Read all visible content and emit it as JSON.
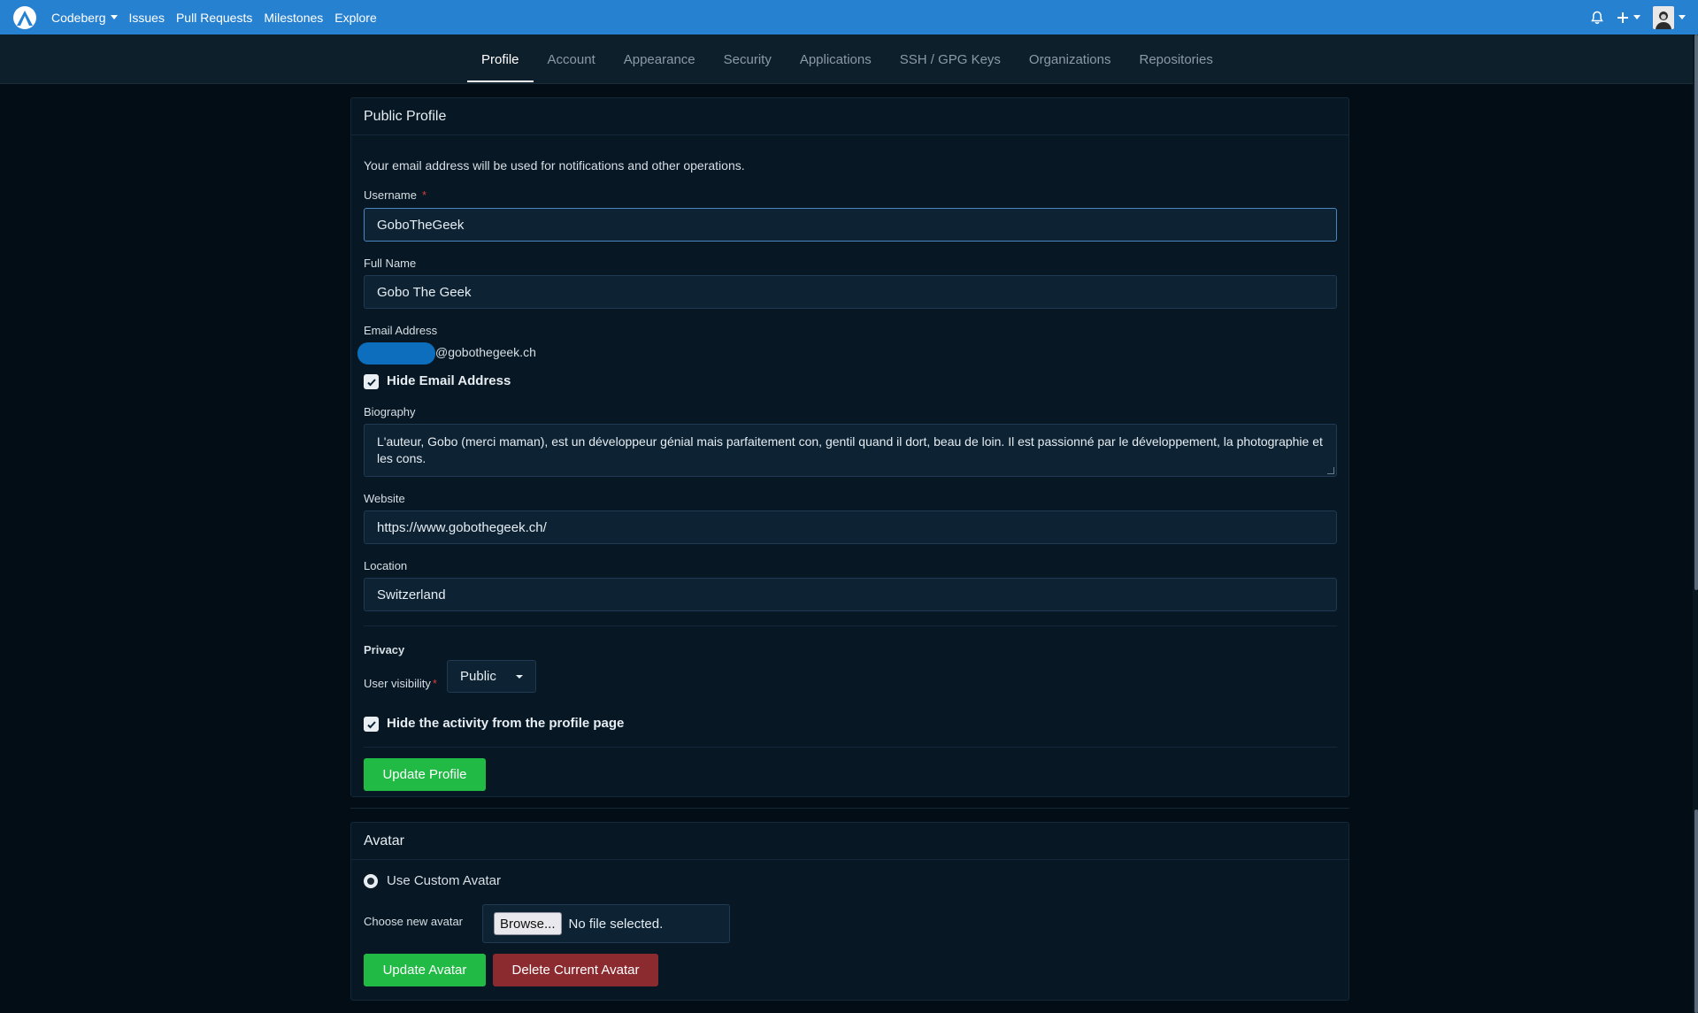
{
  "navbar": {
    "brand": "Codeberg",
    "links": [
      "Issues",
      "Pull Requests",
      "Milestones",
      "Explore"
    ]
  },
  "tabs": [
    "Profile",
    "Account",
    "Appearance",
    "Security",
    "Applications",
    "SSH / GPG Keys",
    "Organizations",
    "Repositories"
  ],
  "profile": {
    "heading": "Public Profile",
    "email_note": "Your email address will be used for notifications and other operations.",
    "username_label": "Username",
    "required_mark": "*",
    "username_value": "GoboTheGeek",
    "fullname_label": "Full Name",
    "fullname_value": "Gobo The Geek",
    "email_label": "Email Address",
    "email_domain": "@gobothegeek.ch",
    "hide_email_label": "Hide Email Address",
    "bio_label": "Biography",
    "bio_value": "L'auteur, Gobo (merci maman), est un développeur génial mais parfaitement con, gentil quand il dort, beau de loin. Il est passionné par le développement, la photographie et les cons.",
    "website_label": "Website",
    "website_value": "https://www.gobothegeek.ch/",
    "location_label": "Location",
    "location_value": "Switzerland",
    "privacy_label": "Privacy",
    "visibility_label": "User visibility",
    "visibility_value": "Public",
    "hide_activity_label": "Hide the activity from the profile page",
    "update_button": "Update Profile"
  },
  "avatar": {
    "heading": "Avatar",
    "custom_avatar_label": "Use Custom Avatar",
    "choose_label": "Choose new avatar",
    "browse_label": "Browse...",
    "no_file_label": "No file selected.",
    "update_button": "Update Avatar",
    "delete_button": "Delete Current Avatar"
  },
  "colors": {
    "navbar": "#2781d1",
    "primary_button": "#21ba45",
    "danger_button": "#8b2a2f"
  }
}
